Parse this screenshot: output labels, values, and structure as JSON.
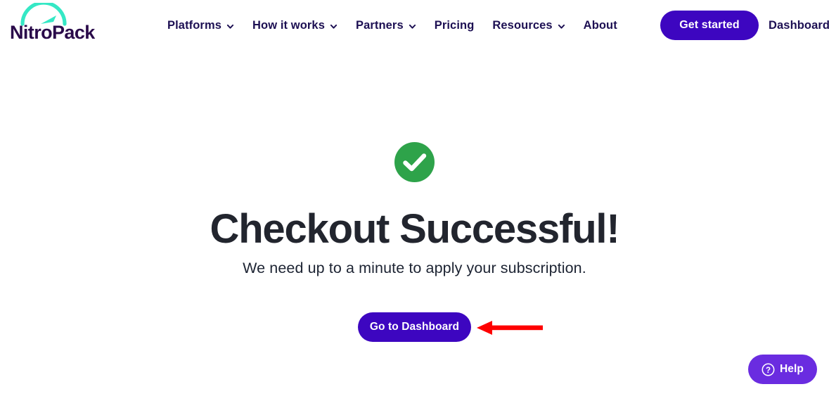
{
  "header": {
    "logo": {
      "name": "NitroPack",
      "wordmark": "NitroPack",
      "arc_color": "#35e8c5",
      "text_color": "#2a0a4a"
    },
    "nav_items": [
      {
        "label": "Platforms",
        "has_dropdown": true,
        "icon": "chevron-down-icon"
      },
      {
        "label": "How it works",
        "has_dropdown": true,
        "icon": "chevron-down-icon"
      },
      {
        "label": "Partners",
        "has_dropdown": true,
        "icon": "chevron-down-icon"
      },
      {
        "label": "Pricing",
        "has_dropdown": false,
        "icon": ""
      },
      {
        "label": "Resources",
        "has_dropdown": true,
        "icon": "chevron-down-icon"
      },
      {
        "label": "About",
        "has_dropdown": false,
        "icon": ""
      }
    ],
    "cta_label": "Get started",
    "cta_color": "#3d06c0",
    "dashboard_link": "Dashboard",
    "nav_text_color": "#1d1053"
  },
  "main": {
    "status_icon": "check-circle-icon",
    "status_icon_color": "#2ea34a",
    "headline": "Checkout Successful!",
    "headline_color": "#22252e",
    "subhead": "We need up to a minute to apply your subscription.",
    "primary_button_label": "Go to Dashboard",
    "primary_button_color": "#3d06c0",
    "annotation": {
      "type": "arrow-left",
      "color": "#fe0000",
      "points_to": "Go to Dashboard"
    }
  },
  "help_widget": {
    "label": "Help",
    "icon": "question-mark-circle-icon",
    "background_color": "#6a2ce0"
  }
}
